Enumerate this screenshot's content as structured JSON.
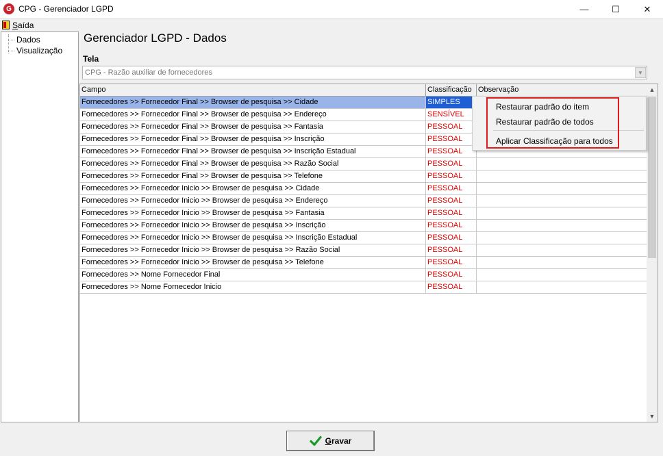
{
  "window": {
    "title": "CPG - Gerenciador LGPD",
    "app_icon": "cpg-logo-icon",
    "controls": [
      "minimize",
      "maximize",
      "close"
    ]
  },
  "menu": {
    "exit_label": "Saída",
    "exit_icon": "door-exit-icon"
  },
  "tree": {
    "items": [
      "Dados",
      "Visualização"
    ]
  },
  "main": {
    "heading": "Gerenciador LGPD - Dados",
    "tela_label": "Tela",
    "tela_value": "CPG - Razão auxiliar de fornecedores"
  },
  "grid": {
    "columns": [
      "Campo",
      "Classificação",
      "Observação"
    ],
    "rows": [
      {
        "campo": "Fornecedores >> Fornecedor  Final >> Browser de pesquisa >> Cidade",
        "classificacao": "SIMPLES",
        "observacao": ""
      },
      {
        "campo": "Fornecedores >> Fornecedor  Final >> Browser de pesquisa >> Endereço",
        "classificacao": "SENSÍVEL",
        "observacao": ""
      },
      {
        "campo": "Fornecedores >> Fornecedor  Final >> Browser de pesquisa >> Fantasia",
        "classificacao": "PESSOAL",
        "observacao": ""
      },
      {
        "campo": "Fornecedores >> Fornecedor  Final >> Browser de pesquisa >> Inscrição",
        "classificacao": "PESSOAL",
        "observacao": ""
      },
      {
        "campo": "Fornecedores >> Fornecedor  Final >> Browser de pesquisa >> Inscrição Estadual",
        "classificacao": "PESSOAL",
        "observacao": ""
      },
      {
        "campo": "Fornecedores >> Fornecedor  Final >> Browser de pesquisa >> Razão Social",
        "classificacao": "PESSOAL",
        "observacao": ""
      },
      {
        "campo": "Fornecedores >> Fornecedor  Final >> Browser de pesquisa >> Telefone",
        "classificacao": "PESSOAL",
        "observacao": ""
      },
      {
        "campo": "Fornecedores >> Fornecedor  Inicio >> Browser de pesquisa >> Cidade",
        "classificacao": "PESSOAL",
        "observacao": ""
      },
      {
        "campo": "Fornecedores >> Fornecedor  Inicio >> Browser de pesquisa >> Endereço",
        "classificacao": "PESSOAL",
        "observacao": ""
      },
      {
        "campo": "Fornecedores >> Fornecedor  Inicio >> Browser de pesquisa >> Fantasia",
        "classificacao": "PESSOAL",
        "observacao": ""
      },
      {
        "campo": "Fornecedores >> Fornecedor  Inicio >> Browser de pesquisa >> Inscrição",
        "classificacao": "PESSOAL",
        "observacao": ""
      },
      {
        "campo": "Fornecedores >> Fornecedor  Inicio >> Browser de pesquisa >> Inscrição Estadual",
        "classificacao": "PESSOAL",
        "observacao": ""
      },
      {
        "campo": "Fornecedores >> Fornecedor  Inicio >> Browser de pesquisa >> Razão Social",
        "classificacao": "PESSOAL",
        "observacao": ""
      },
      {
        "campo": "Fornecedores >> Fornecedor  Inicio >> Browser de pesquisa >> Telefone",
        "classificacao": "PESSOAL",
        "observacao": ""
      },
      {
        "campo": "Fornecedores >> Nome Fornecedor Final",
        "classificacao": "PESSOAL",
        "observacao": ""
      },
      {
        "campo": "Fornecedores >> Nome Fornecedor Inicio",
        "classificacao": "PESSOAL",
        "observacao": ""
      }
    ]
  },
  "context_menu": {
    "items": [
      "Restaurar padrão do item",
      "Restaurar padrão de todos",
      "Aplicar Classificação para todos"
    ]
  },
  "save_button": {
    "label": "Gravar",
    "icon": "green-check-icon"
  },
  "colors": {
    "classification_text": "#e00000",
    "selected_row": "#98b4e8",
    "selected_cell": "#1f5fd6",
    "highlight_box": "#e01b1b",
    "check_icon": "#1a9a2a"
  }
}
